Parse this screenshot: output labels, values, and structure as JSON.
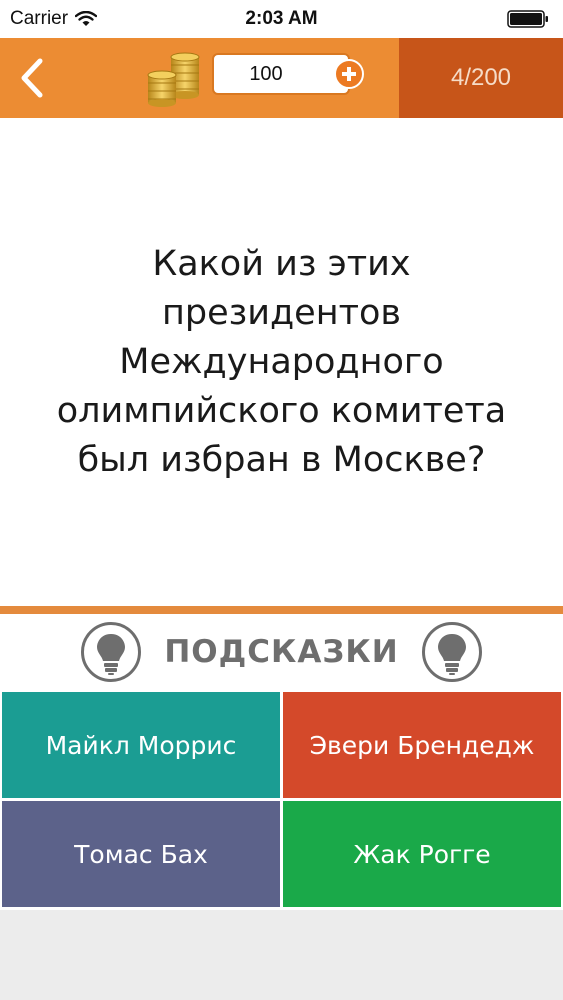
{
  "status_bar": {
    "carrier": "Carrier",
    "time": "2:03 AM"
  },
  "top_bar": {
    "coins_value": "100",
    "progress": "4/200",
    "colors": {
      "bar": "#ec8c33",
      "progress_box": "#c75519"
    }
  },
  "question": {
    "lines": [
      "Какой из этих",
      "президентов",
      "Международного",
      "олимпийского комитета",
      "был избран в Москве?"
    ]
  },
  "hints": {
    "label": "ПОДСКАЗКИ"
  },
  "answers": [
    {
      "label": "Майкл Моррис",
      "color": "#1b9d93"
    },
    {
      "label": "Эвери Брендедж",
      "color": "#d4492a"
    },
    {
      "label": "Томас Бах",
      "color": "#5c628a"
    },
    {
      "label": "Жак Рогге",
      "color": "#1aa949"
    }
  ],
  "icons": [
    "wifi-icon",
    "battery-icon",
    "back-chevron-icon",
    "coins-icon",
    "plus-icon",
    "lightbulb-icon"
  ]
}
